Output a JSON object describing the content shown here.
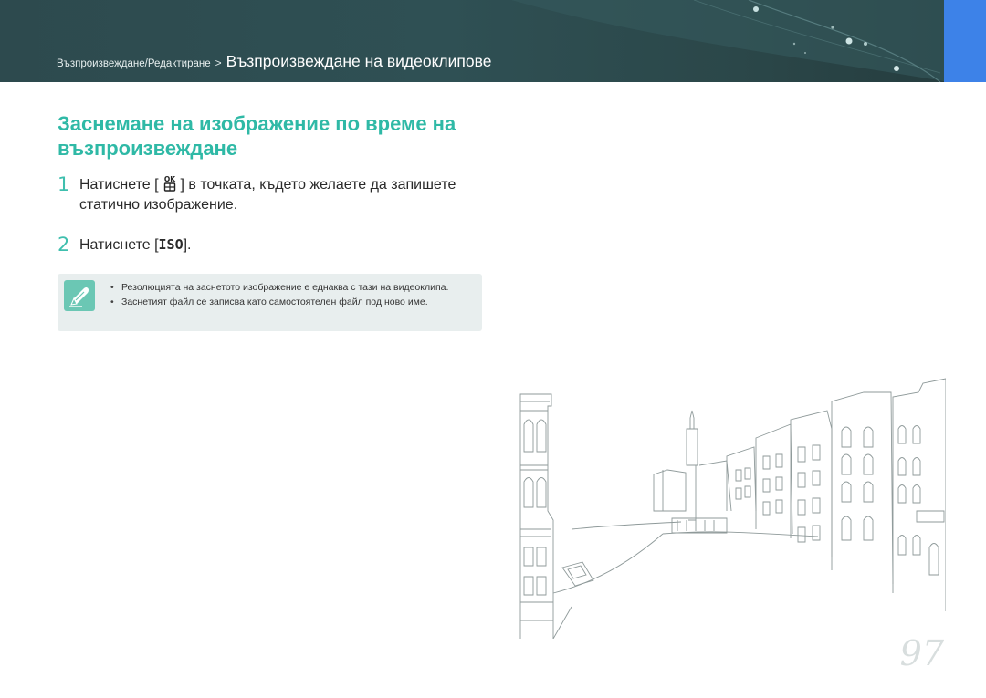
{
  "header": {
    "breadcrumb_section": "Възпроизвеждане/Редактиране",
    "breadcrumb_separator": ">",
    "breadcrumb_page": "Възпроизвеждане на видеоклипове"
  },
  "title": "Заснемане на изображение по време на възпроизвеждане",
  "steps": [
    {
      "number": "1",
      "before_button": "Натиснете [",
      "button_icon": "ok-button-icon",
      "after_button": "] в точката, където желаете да запишете статично изображение."
    },
    {
      "number": "2",
      "before_button": "Натиснете [",
      "button_label": "ISO",
      "after_button": "]."
    }
  ],
  "note": {
    "icon": "pencil-note-icon",
    "items": [
      "Резолюцията на заснетото изображение е еднаква с тази на видеоклипа.",
      "Заснетият файл се записва като самостоятелен файл под ново име."
    ]
  },
  "page_number": "97",
  "colors": {
    "header_bg": "#2f5054",
    "accent_teal": "#2fb9a6",
    "tab_blue": "#3d82e8",
    "note_bg": "#e8eeee",
    "note_icon_bg": "#6bc7b4"
  }
}
